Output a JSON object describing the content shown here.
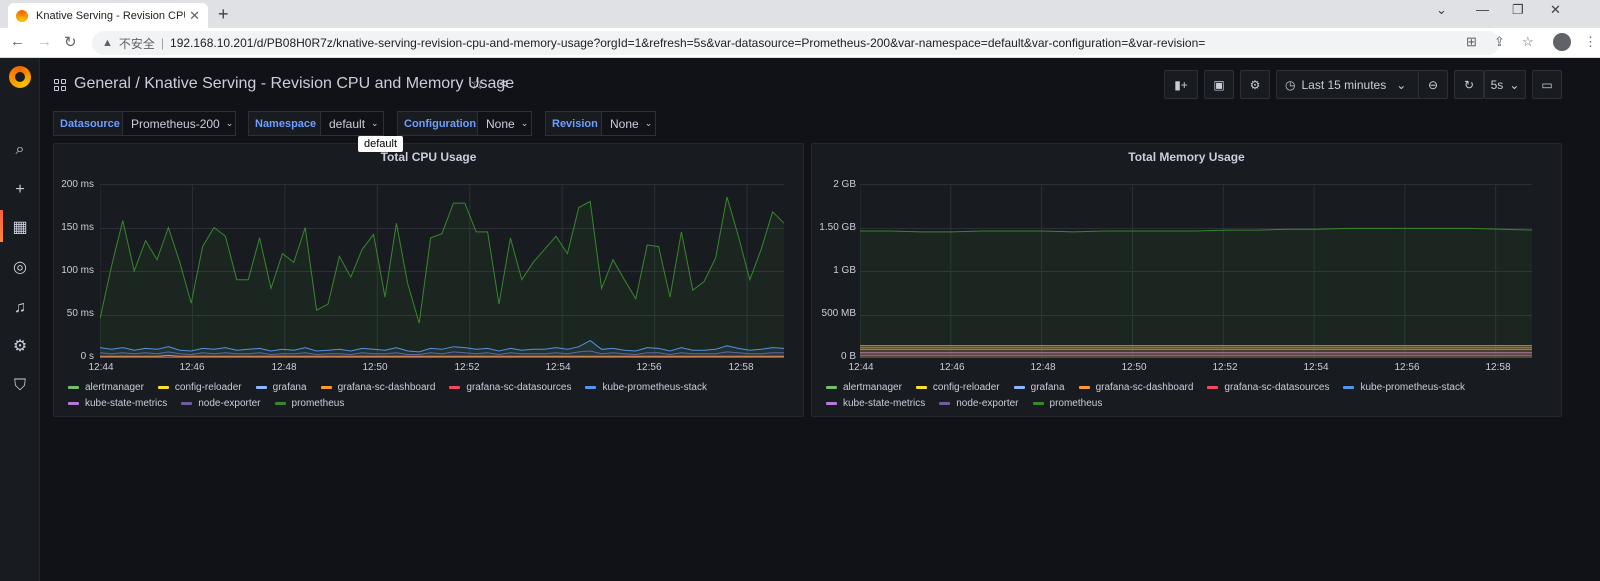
{
  "browser": {
    "tab_title": "Knative Serving - Revision CPU",
    "insecure_label": "不安全",
    "url": "192.168.10.201/d/PB08H0R7z/knative-serving-revision-cpu-and-memory-usage?orgId=1&refresh=5s&var-datasource=Prometheus-200&var-namespace=default&var-configuration=&var-revision="
  },
  "header": {
    "breadcrumb": "General  / Knative Serving - Revision CPU and Memory Usage",
    "time_range": "Last 15 minutes",
    "refresh": "5s"
  },
  "variables": [
    {
      "label": "Datasource",
      "value": "Prometheus-200"
    },
    {
      "label": "Namespace",
      "value": "default"
    },
    {
      "label": "Configuration",
      "value": "None"
    },
    {
      "label": "Revision",
      "value": "None"
    }
  ],
  "tooltip": "default",
  "colors": {
    "alertmanager": "#73bf69",
    "config-reloader": "#fade2a",
    "grafana": "#8ab8ff",
    "grafana-sc-dashboard": "#ff9830",
    "grafana-sc-datasources": "#f2495c",
    "kube-prometheus-stack": "#5794f2",
    "kube-state-metrics": "#b877d9",
    "node-exporter": "#705da0",
    "prometheus": "#37872d"
  },
  "legend": [
    [
      "alertmanager",
      "config-reloader",
      "grafana",
      "grafana-sc-dashboard",
      "grafana-sc-datasources",
      "kube-prometheus-stack"
    ],
    [
      "kube-state-metrics",
      "node-exporter",
      "prometheus"
    ]
  ],
  "chart_data": [
    {
      "type": "line",
      "title": "Total CPU Usage",
      "y_ticks": [
        "200 ms",
        "150 ms",
        "100 ms",
        "50 ms",
        "0 s"
      ],
      "x_ticks": [
        "12:44",
        "12:46",
        "12:48",
        "12:50",
        "12:52",
        "12:54",
        "12:56",
        "12:58"
      ],
      "ylim": [
        0,
        200
      ],
      "series": [
        {
          "name": "prometheus",
          "values": [
            45,
            105,
            158,
            100,
            135,
            113,
            150,
            110,
            63,
            128,
            150,
            140,
            90,
            90,
            138,
            80,
            120,
            110,
            150,
            55,
            62,
            117,
            93,
            125,
            142,
            70,
            155,
            85,
            40,
            138,
            143,
            178,
            178,
            145,
            145,
            62,
            138,
            90,
            110,
            125,
            140,
            120,
            173,
            180,
            80,
            113,
            90,
            68,
            130,
            128,
            70,
            145,
            78,
            88,
            115,
            185,
            140,
            90,
            125,
            168,
            155
          ]
        },
        {
          "name": "kube-prometheus-stack",
          "values": [
            12,
            10,
            12,
            9,
            11,
            10,
            13,
            9,
            8,
            11,
            10,
            12,
            9,
            10,
            11,
            8,
            10,
            9,
            12,
            8,
            9,
            10,
            8,
            11,
            10,
            9,
            12,
            8,
            7,
            11,
            10,
            13,
            12,
            10,
            11,
            8,
            11,
            9,
            10,
            10,
            12,
            10,
            13,
            20,
            10,
            11,
            9,
            8,
            12,
            11,
            8,
            12,
            9,
            9,
            10,
            14,
            11,
            9,
            10,
            12,
            11
          ]
        },
        {
          "name": "node-exporter",
          "values": [
            6,
            5,
            6,
            5,
            6,
            5,
            7,
            5,
            4,
            6,
            5,
            6,
            5,
            5,
            6,
            4,
            5,
            5,
            6,
            4,
            5,
            5,
            4,
            6,
            5,
            5,
            6,
            4,
            4,
            6,
            5,
            7,
            6,
            5,
            6,
            4,
            6,
            5,
            5,
            5,
            6,
            5,
            7,
            8,
            5,
            6,
            5,
            4,
            6,
            6,
            4,
            6,
            5,
            5,
            5,
            7,
            6,
            5,
            5,
            6,
            6
          ]
        },
        {
          "name": "grafana-sc-dashboard",
          "values": [
            2,
            2,
            2,
            2,
            2,
            2,
            3,
            2,
            2,
            2,
            2,
            2,
            2,
            2,
            2,
            2,
            2,
            2,
            2,
            2,
            2,
            2,
            2,
            2,
            2,
            2,
            2,
            2,
            2,
            2,
            2,
            2,
            2,
            2,
            2,
            2,
            2,
            2,
            2,
            2,
            2,
            2,
            2,
            2,
            2,
            2,
            2,
            2,
            2,
            2,
            2,
            2,
            2,
            2,
            2,
            2,
            2,
            2,
            2,
            2,
            2
          ]
        },
        {
          "name": "grafana-sc-datasources",
          "values": [
            1,
            1,
            1,
            1,
            1,
            1,
            1,
            1,
            1,
            1,
            1,
            1,
            1,
            1,
            1,
            1,
            1,
            1,
            1,
            1,
            1,
            1,
            1,
            1,
            1,
            1,
            1,
            1,
            1,
            1,
            1,
            1,
            1,
            1,
            1,
            1,
            1,
            1,
            1,
            1,
            1,
            1,
            1,
            1,
            1,
            1,
            1,
            1,
            1,
            1,
            1,
            1,
            1,
            1,
            1,
            1,
            1,
            1,
            1,
            1,
            1
          ]
        }
      ]
    },
    {
      "type": "line",
      "title": "Total Memory Usage",
      "y_ticks": [
        "2 GB",
        "1.50 GB",
        "1 GB",
        "500 MB",
        "0 B"
      ],
      "x_ticks": [
        "12:44",
        "12:46",
        "12:48",
        "12:50",
        "12:52",
        "12:54",
        "12:56",
        "12:58"
      ],
      "ylim": [
        0,
        2
      ],
      "series": [
        {
          "name": "prometheus",
          "values": [
            1.46,
            1.46,
            1.45,
            1.45,
            1.46,
            1.46,
            1.46,
            1.45,
            1.46,
            1.46,
            1.46,
            1.46,
            1.47,
            1.47,
            1.48,
            1.48,
            1.49,
            1.49,
            1.49,
            1.49,
            1.49,
            1.48,
            1.47
          ]
        },
        {
          "name": "grafana-sc-dashboard",
          "values": [
            0.14,
            0.14,
            0.14,
            0.14,
            0.14,
            0.14,
            0.14,
            0.14,
            0.14,
            0.14,
            0.14,
            0.14,
            0.14,
            0.14,
            0.14,
            0.14,
            0.14,
            0.14,
            0.14,
            0.14,
            0.14,
            0.14,
            0.14
          ]
        },
        {
          "name": "grafana-sc-datasources",
          "values": [
            0.12,
            0.12,
            0.12,
            0.12,
            0.12,
            0.12,
            0.12,
            0.12,
            0.12,
            0.12,
            0.12,
            0.12,
            0.12,
            0.12,
            0.12,
            0.12,
            0.12,
            0.12,
            0.12,
            0.12,
            0.12,
            0.12,
            0.12
          ]
        },
        {
          "name": "alertmanager",
          "values": [
            0.1,
            0.1,
            0.1,
            0.1,
            0.1,
            0.1,
            0.1,
            0.1,
            0.1,
            0.1,
            0.1,
            0.1,
            0.1,
            0.1,
            0.1,
            0.1,
            0.1,
            0.1,
            0.1,
            0.1,
            0.1,
            0.1,
            0.1
          ]
        },
        {
          "name": "kube-state-metrics",
          "values": [
            0.06,
            0.06,
            0.06,
            0.06,
            0.06,
            0.06,
            0.06,
            0.06,
            0.06,
            0.06,
            0.06,
            0.06,
            0.06,
            0.06,
            0.06,
            0.06,
            0.06,
            0.06,
            0.06,
            0.06,
            0.06,
            0.06,
            0.06
          ]
        },
        {
          "name": "node-exporter",
          "values": [
            0.03,
            0.03,
            0.03,
            0.03,
            0.03,
            0.03,
            0.03,
            0.03,
            0.03,
            0.03,
            0.03,
            0.03,
            0.03,
            0.03,
            0.03,
            0.03,
            0.03,
            0.03,
            0.03,
            0.03,
            0.03,
            0.03,
            0.03
          ]
        }
      ]
    }
  ]
}
